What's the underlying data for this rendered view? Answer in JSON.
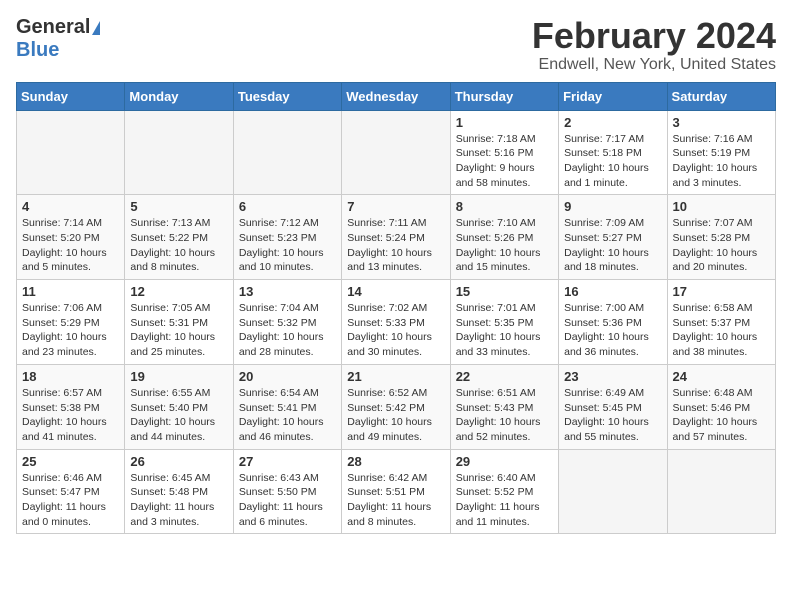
{
  "header": {
    "logo_general": "General",
    "logo_blue": "Blue",
    "title": "February 2024",
    "subtitle": "Endwell, New York, United States"
  },
  "days_of_week": [
    "Sunday",
    "Monday",
    "Tuesday",
    "Wednesday",
    "Thursday",
    "Friday",
    "Saturday"
  ],
  "weeks": [
    [
      {
        "day": "",
        "info": ""
      },
      {
        "day": "",
        "info": ""
      },
      {
        "day": "",
        "info": ""
      },
      {
        "day": "",
        "info": ""
      },
      {
        "day": "1",
        "info": "Sunrise: 7:18 AM\nSunset: 5:16 PM\nDaylight: 9 hours\nand 58 minutes."
      },
      {
        "day": "2",
        "info": "Sunrise: 7:17 AM\nSunset: 5:18 PM\nDaylight: 10 hours\nand 1 minute."
      },
      {
        "day": "3",
        "info": "Sunrise: 7:16 AM\nSunset: 5:19 PM\nDaylight: 10 hours\nand 3 minutes."
      }
    ],
    [
      {
        "day": "4",
        "info": "Sunrise: 7:14 AM\nSunset: 5:20 PM\nDaylight: 10 hours\nand 5 minutes."
      },
      {
        "day": "5",
        "info": "Sunrise: 7:13 AM\nSunset: 5:22 PM\nDaylight: 10 hours\nand 8 minutes."
      },
      {
        "day": "6",
        "info": "Sunrise: 7:12 AM\nSunset: 5:23 PM\nDaylight: 10 hours\nand 10 minutes."
      },
      {
        "day": "7",
        "info": "Sunrise: 7:11 AM\nSunset: 5:24 PM\nDaylight: 10 hours\nand 13 minutes."
      },
      {
        "day": "8",
        "info": "Sunrise: 7:10 AM\nSunset: 5:26 PM\nDaylight: 10 hours\nand 15 minutes."
      },
      {
        "day": "9",
        "info": "Sunrise: 7:09 AM\nSunset: 5:27 PM\nDaylight: 10 hours\nand 18 minutes."
      },
      {
        "day": "10",
        "info": "Sunrise: 7:07 AM\nSunset: 5:28 PM\nDaylight: 10 hours\nand 20 minutes."
      }
    ],
    [
      {
        "day": "11",
        "info": "Sunrise: 7:06 AM\nSunset: 5:29 PM\nDaylight: 10 hours\nand 23 minutes."
      },
      {
        "day": "12",
        "info": "Sunrise: 7:05 AM\nSunset: 5:31 PM\nDaylight: 10 hours\nand 25 minutes."
      },
      {
        "day": "13",
        "info": "Sunrise: 7:04 AM\nSunset: 5:32 PM\nDaylight: 10 hours\nand 28 minutes."
      },
      {
        "day": "14",
        "info": "Sunrise: 7:02 AM\nSunset: 5:33 PM\nDaylight: 10 hours\nand 30 minutes."
      },
      {
        "day": "15",
        "info": "Sunrise: 7:01 AM\nSunset: 5:35 PM\nDaylight: 10 hours\nand 33 minutes."
      },
      {
        "day": "16",
        "info": "Sunrise: 7:00 AM\nSunset: 5:36 PM\nDaylight: 10 hours\nand 36 minutes."
      },
      {
        "day": "17",
        "info": "Sunrise: 6:58 AM\nSunset: 5:37 PM\nDaylight: 10 hours\nand 38 minutes."
      }
    ],
    [
      {
        "day": "18",
        "info": "Sunrise: 6:57 AM\nSunset: 5:38 PM\nDaylight: 10 hours\nand 41 minutes."
      },
      {
        "day": "19",
        "info": "Sunrise: 6:55 AM\nSunset: 5:40 PM\nDaylight: 10 hours\nand 44 minutes."
      },
      {
        "day": "20",
        "info": "Sunrise: 6:54 AM\nSunset: 5:41 PM\nDaylight: 10 hours\nand 46 minutes."
      },
      {
        "day": "21",
        "info": "Sunrise: 6:52 AM\nSunset: 5:42 PM\nDaylight: 10 hours\nand 49 minutes."
      },
      {
        "day": "22",
        "info": "Sunrise: 6:51 AM\nSunset: 5:43 PM\nDaylight: 10 hours\nand 52 minutes."
      },
      {
        "day": "23",
        "info": "Sunrise: 6:49 AM\nSunset: 5:45 PM\nDaylight: 10 hours\nand 55 minutes."
      },
      {
        "day": "24",
        "info": "Sunrise: 6:48 AM\nSunset: 5:46 PM\nDaylight: 10 hours\nand 57 minutes."
      }
    ],
    [
      {
        "day": "25",
        "info": "Sunrise: 6:46 AM\nSunset: 5:47 PM\nDaylight: 11 hours\nand 0 minutes."
      },
      {
        "day": "26",
        "info": "Sunrise: 6:45 AM\nSunset: 5:48 PM\nDaylight: 11 hours\nand 3 minutes."
      },
      {
        "day": "27",
        "info": "Sunrise: 6:43 AM\nSunset: 5:50 PM\nDaylight: 11 hours\nand 6 minutes."
      },
      {
        "day": "28",
        "info": "Sunrise: 6:42 AM\nSunset: 5:51 PM\nDaylight: 11 hours\nand 8 minutes."
      },
      {
        "day": "29",
        "info": "Sunrise: 6:40 AM\nSunset: 5:52 PM\nDaylight: 11 hours\nand 11 minutes."
      },
      {
        "day": "",
        "info": ""
      },
      {
        "day": "",
        "info": ""
      }
    ]
  ]
}
